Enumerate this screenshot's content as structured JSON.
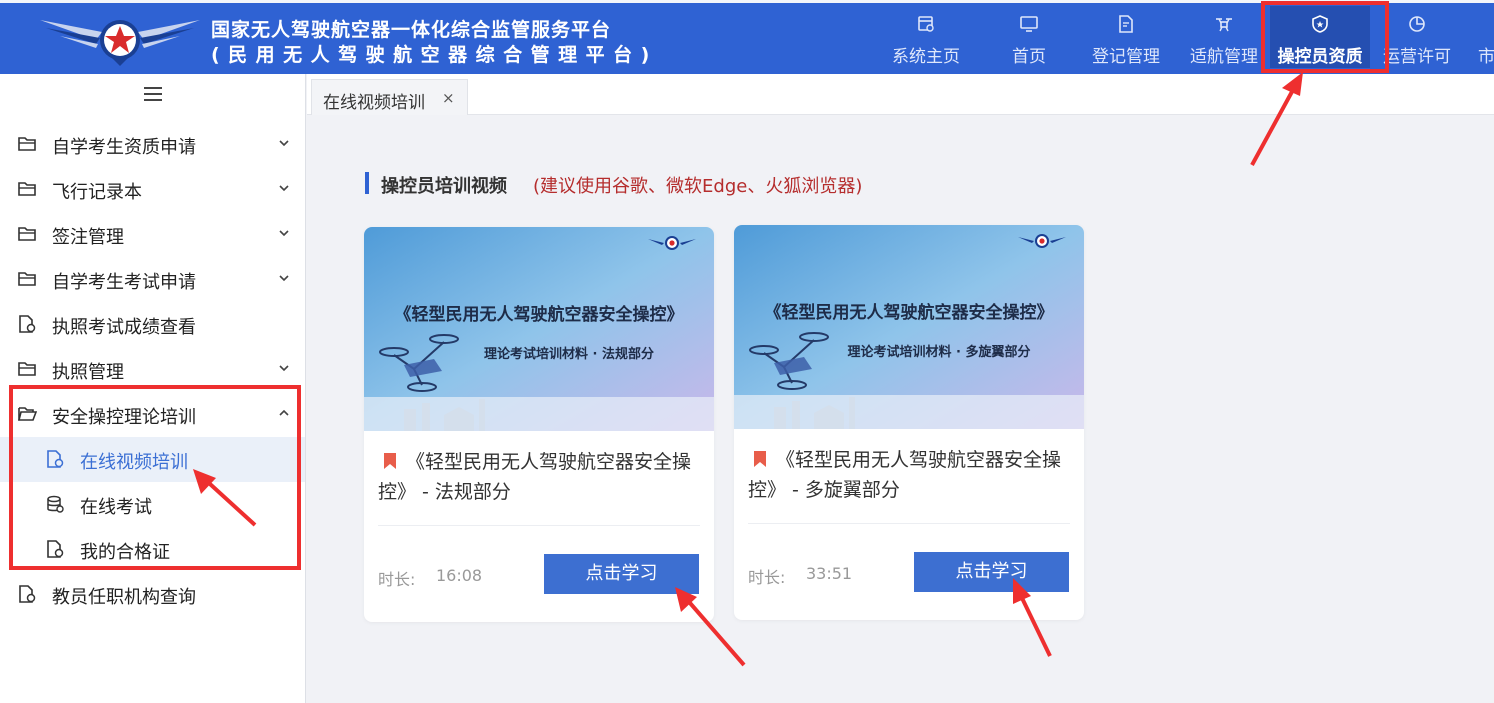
{
  "header": {
    "title_line1": "国家无人驾驶航空器一体化综合监管服务平台",
    "title_line2": "(民用无人驾驶航空器综合管理平台)",
    "nav": [
      {
        "label": "系统主页",
        "icon": "system-home-icon"
      },
      {
        "label": "首页",
        "icon": "monitor-icon"
      },
      {
        "label": "登记管理",
        "icon": "edit-document-icon"
      },
      {
        "label": "适航管理",
        "icon": "drone-icon"
      },
      {
        "label": "操控员资质",
        "icon": "shield-icon",
        "active": true
      },
      {
        "label": "运营许可",
        "icon": "pie-chart-icon"
      },
      {
        "label": "市",
        "icon": ""
      }
    ]
  },
  "sidebar": {
    "items": [
      {
        "label": "自学考生资质申请",
        "icon": "folder-icon",
        "expandable": true
      },
      {
        "label": "飞行记录本",
        "icon": "folder-icon",
        "expandable": true
      },
      {
        "label": "签注管理",
        "icon": "folder-icon",
        "expandable": true
      },
      {
        "label": "自学考生考试申请",
        "icon": "folder-icon",
        "expandable": true
      },
      {
        "label": "执照考试成绩查看",
        "icon": "document-settings-icon",
        "expandable": false
      },
      {
        "label": "执照管理",
        "icon": "folder-icon",
        "expandable": true
      },
      {
        "label": "安全操控理论培训",
        "icon": "folder-open-icon",
        "expandable": true,
        "expanded": true
      },
      {
        "label": "在线视频培训",
        "icon": "document-settings-icon",
        "sub": true,
        "active": true
      },
      {
        "label": "在线考试",
        "icon": "database-icon",
        "sub": true
      },
      {
        "label": "我的合格证",
        "icon": "document-settings-icon",
        "sub": true
      },
      {
        "label": "教员任职机构查询",
        "icon": "document-settings-icon",
        "expandable": false
      }
    ]
  },
  "tabs": [
    {
      "label": "在线视频培训",
      "close": "×"
    }
  ],
  "section": {
    "title": "操控员培训视频",
    "note": "(建议使用谷歌、微软Edge、火狐浏览器)"
  },
  "cards": [
    {
      "thumb_title": "《轻型民用无人驾驶航空器安全操控》",
      "thumb_subtitle": "理论考试培训材料 · 法规部分",
      "title": "《轻型民用无人驾驶航空器安全操控》 - 法规部分",
      "duration_label": "时长:",
      "duration": "16:08",
      "button": "点击学习"
    },
    {
      "thumb_title": "《轻型民用无人驾驶航空器安全操控》",
      "thumb_subtitle": "理论考试培训材料 · 多旋翼部分",
      "title": "《轻型民用无人驾驶航空器安全操控》 - 多旋翼部分",
      "duration_label": "时长:",
      "duration": "33:51",
      "button": "点击学习"
    }
  ],
  "colors": {
    "header_bg": "#2f62d3",
    "nav_active_bg": "#254fb1",
    "accent": "#3d6fd1",
    "note_red": "#b52d2d",
    "annotation_red": "#ee2f2f"
  }
}
